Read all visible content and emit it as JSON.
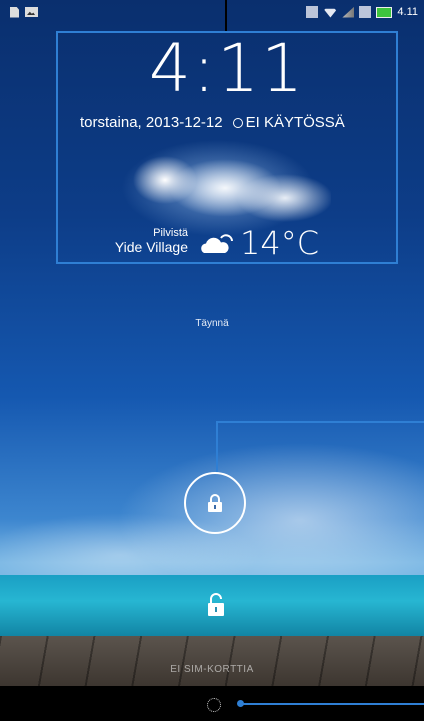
{
  "status_bar": {
    "time": "4.11",
    "left_icons": [
      "file-icon",
      "image-icon"
    ],
    "right_icons": [
      "mute-icon",
      "wifi-icon",
      "signal-icon",
      "data-icon",
      "battery-icon"
    ],
    "battery_color": "#3ec43e"
  },
  "lockscreen": {
    "clock": "4:11",
    "date": "torstaina, 2013-12-12",
    "alarm_status": "EI KÄYTÖSSÄ",
    "charge_status": "Täynnä",
    "no_sim_text": "EI SIM-KORTTIA"
  },
  "weather": {
    "condition": "Pilvistä",
    "location": "Yide Village",
    "temperature": "14°C",
    "icon": "cloud-sun-icon"
  },
  "colors": {
    "accent": "#2f7fd4"
  }
}
